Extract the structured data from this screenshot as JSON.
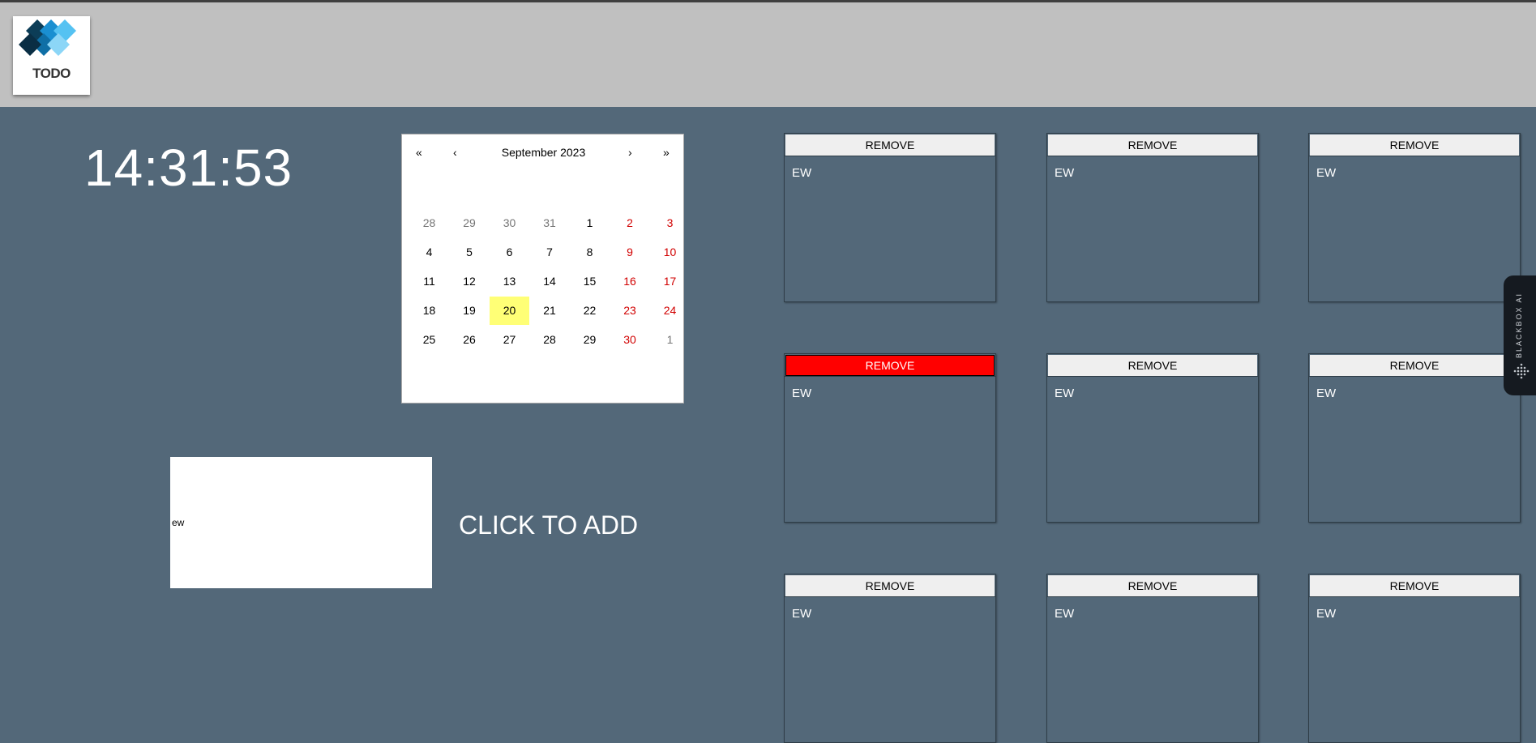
{
  "app": {
    "logo_text": "TODO",
    "clock": "14:31:53"
  },
  "calendar": {
    "title": "September 2023",
    "nav": {
      "prev_year": "«",
      "prev_month": "‹",
      "next_month": "›",
      "next_year": "»"
    },
    "weeks": [
      [
        {
          "d": "28",
          "t": "other"
        },
        {
          "d": "29",
          "t": "other"
        },
        {
          "d": "30",
          "t": "other"
        },
        {
          "d": "31",
          "t": "other"
        },
        {
          "d": "1",
          "t": ""
        },
        {
          "d": "2",
          "t": "weekend"
        },
        {
          "d": "3",
          "t": "weekend"
        }
      ],
      [
        {
          "d": "4",
          "t": ""
        },
        {
          "d": "5",
          "t": ""
        },
        {
          "d": "6",
          "t": ""
        },
        {
          "d": "7",
          "t": ""
        },
        {
          "d": "8",
          "t": ""
        },
        {
          "d": "9",
          "t": "weekend"
        },
        {
          "d": "10",
          "t": "weekend"
        }
      ],
      [
        {
          "d": "11",
          "t": ""
        },
        {
          "d": "12",
          "t": ""
        },
        {
          "d": "13",
          "t": ""
        },
        {
          "d": "14",
          "t": ""
        },
        {
          "d": "15",
          "t": ""
        },
        {
          "d": "16",
          "t": "weekend"
        },
        {
          "d": "17",
          "t": "weekend"
        }
      ],
      [
        {
          "d": "18",
          "t": ""
        },
        {
          "d": "19",
          "t": ""
        },
        {
          "d": "20",
          "t": "today"
        },
        {
          "d": "21",
          "t": ""
        },
        {
          "d": "22",
          "t": ""
        },
        {
          "d": "23",
          "t": "weekend"
        },
        {
          "d": "24",
          "t": "weekend"
        }
      ],
      [
        {
          "d": "25",
          "t": ""
        },
        {
          "d": "26",
          "t": ""
        },
        {
          "d": "27",
          "t": ""
        },
        {
          "d": "28",
          "t": ""
        },
        {
          "d": "29",
          "t": ""
        },
        {
          "d": "30",
          "t": "weekend"
        },
        {
          "d": "1",
          "t": "other"
        }
      ]
    ]
  },
  "add_form": {
    "input_value": "ew",
    "add_label": "CLICK TO ADD"
  },
  "cards": [
    {
      "remove_label": "REMOVE",
      "text": "EW",
      "highlighted": false
    },
    {
      "remove_label": "REMOVE",
      "text": "EW",
      "highlighted": false
    },
    {
      "remove_label": "REMOVE",
      "text": "EW",
      "highlighted": false
    },
    {
      "remove_label": "REMOVE",
      "text": "EW",
      "highlighted": true
    },
    {
      "remove_label": "REMOVE",
      "text": "EW",
      "highlighted": false
    },
    {
      "remove_label": "REMOVE",
      "text": "EW",
      "highlighted": false
    },
    {
      "remove_label": "REMOVE",
      "text": "EW",
      "highlighted": false
    },
    {
      "remove_label": "REMOVE",
      "text": "EW",
      "highlighted": false
    },
    {
      "remove_label": "REMOVE",
      "text": "EW",
      "highlighted": false
    }
  ],
  "side_tab": {
    "label": "BLACKBOX AI"
  },
  "colors": {
    "background": "#536879",
    "header": "#c0c0c0",
    "remove_active": "#ff0000",
    "today_highlight": "#ffff76",
    "weekend": "#d10000"
  }
}
